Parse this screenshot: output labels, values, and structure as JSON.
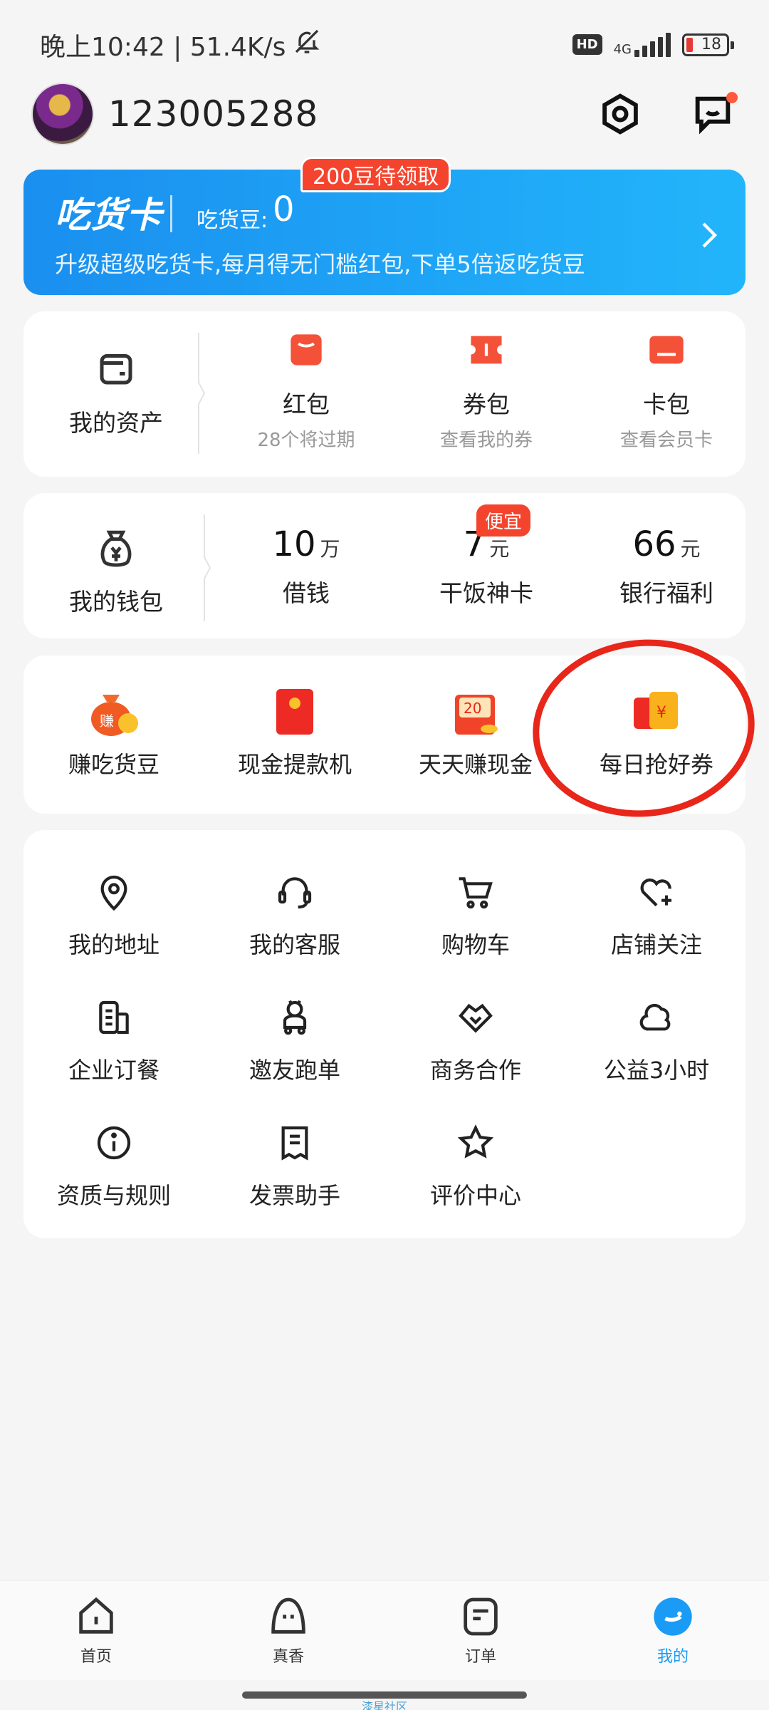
{
  "status_bar": {
    "time_speed": "晚上10:42 | 51.4K/s",
    "hd": "HD",
    "network": "4G",
    "battery": "18"
  },
  "header": {
    "user_id": "123005288"
  },
  "vip_card": {
    "title": "吃货卡",
    "bean_label": "吃货豆:",
    "bean_value": "0",
    "description": "升级超级吃货卡,每月得无门槛红包,下单5倍返吃货豆",
    "pending_pill": "200豆待领取"
  },
  "assets": {
    "title": "我的资产",
    "items": [
      {
        "label": "红包",
        "sub": "28个将过期"
      },
      {
        "label": "券包",
        "sub": "查看我的券"
      },
      {
        "label": "卡包",
        "sub": "查看会员卡"
      }
    ]
  },
  "wallet": {
    "title": "我的钱包",
    "items": [
      {
        "value": "10",
        "unit": "万",
        "label": "借钱"
      },
      {
        "value": "7",
        "unit": "元",
        "label": "干饭神卡",
        "badge": "便宜"
      },
      {
        "value": "66",
        "unit": "元",
        "label": "银行福利"
      }
    ]
  },
  "promos": {
    "items": [
      {
        "label": "赚吃货豆",
        "icon": "coin-bag-icon"
      },
      {
        "label": "现金提款机",
        "icon": "red-envelope-icon"
      },
      {
        "label": "天天赚现金",
        "icon": "cash-20-icon"
      },
      {
        "label": "每日抢好券",
        "icon": "coupon-icon"
      }
    ]
  },
  "services": {
    "items": [
      {
        "label": "我的地址",
        "icon": "location-pin-icon"
      },
      {
        "label": "我的客服",
        "icon": "headset-icon"
      },
      {
        "label": "购物车",
        "icon": "shopping-cart-icon"
      },
      {
        "label": "店铺关注",
        "icon": "heart-plus-icon"
      },
      {
        "label": "企业订餐",
        "icon": "building-icon"
      },
      {
        "label": "邀友跑单",
        "icon": "rider-icon"
      },
      {
        "label": "商务合作",
        "icon": "handshake-icon"
      },
      {
        "label": "公益3小时",
        "icon": "cloud-icon"
      },
      {
        "label": "资质与规则",
        "icon": "info-icon"
      },
      {
        "label": "发票助手",
        "icon": "receipt-icon"
      },
      {
        "label": "评价中心",
        "icon": "star-icon"
      }
    ]
  },
  "tabbar": {
    "tabs": [
      {
        "label": "首页"
      },
      {
        "label": "真香"
      },
      {
        "label": "订单"
      },
      {
        "label": "我的"
      }
    ]
  },
  "watermark": "漆星社区",
  "colors": {
    "accent_blue": "#1a9bf5",
    "promo_red": "#f4442e",
    "annotation_red": "#e8261a"
  }
}
